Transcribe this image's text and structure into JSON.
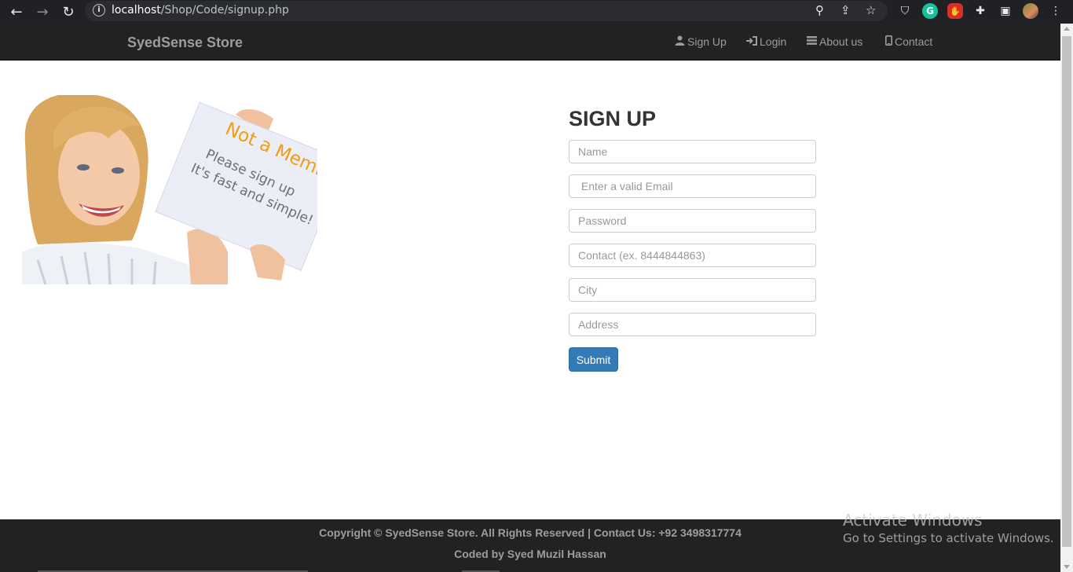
{
  "browser": {
    "url_host": "localhost",
    "url_path": "/Shop/Code/signup.php",
    "icons": [
      "back-icon",
      "forward-icon",
      "reload-icon",
      "site-info-icon",
      "zoom-icon",
      "share-icon",
      "bookmark-star-icon",
      "brave-shield-icon",
      "grammarly-icon",
      "stop-extension-icon",
      "extensions-puzzle-icon",
      "side-panel-icon",
      "profile-avatar-icon",
      "menu-kebab-icon"
    ],
    "grammarly_letter": "G"
  },
  "navbar": {
    "brand": "SyedSense Store",
    "links": [
      {
        "label": "Sign Up",
        "icon": "user-icon"
      },
      {
        "label": "Login",
        "icon": "log-in-icon"
      },
      {
        "label": "About us",
        "icon": "list-icon"
      },
      {
        "label": "Contact",
        "icon": "phone-icon"
      }
    ]
  },
  "hero": {
    "image": "woman-holding-sign",
    "sign_heading": "Not a Member?",
    "sign_line1": "Please sign up",
    "sign_line2": "It's fast and simple!"
  },
  "form": {
    "title": "SIGN UP",
    "fields": [
      {
        "name": "name",
        "placeholder": "Name"
      },
      {
        "name": "email",
        "placeholder": " Enter a valid Email"
      },
      {
        "name": "password",
        "placeholder": "Password"
      },
      {
        "name": "contact",
        "placeholder": "Contact (ex. 8444844863)"
      },
      {
        "name": "city",
        "placeholder": "City"
      },
      {
        "name": "address",
        "placeholder": "Address"
      }
    ],
    "submit_label": "Submit",
    "submit_color": "#337ab7"
  },
  "footer": {
    "copyright": "Copyright © SyedSense Store. All Rights Reserved | Contact Us: +92 3498317774",
    "credit": "Coded by Syed Muzil Hassan"
  },
  "watermark": {
    "line1": "Activate Windows",
    "line2": "Go to Settings to activate Windows."
  }
}
